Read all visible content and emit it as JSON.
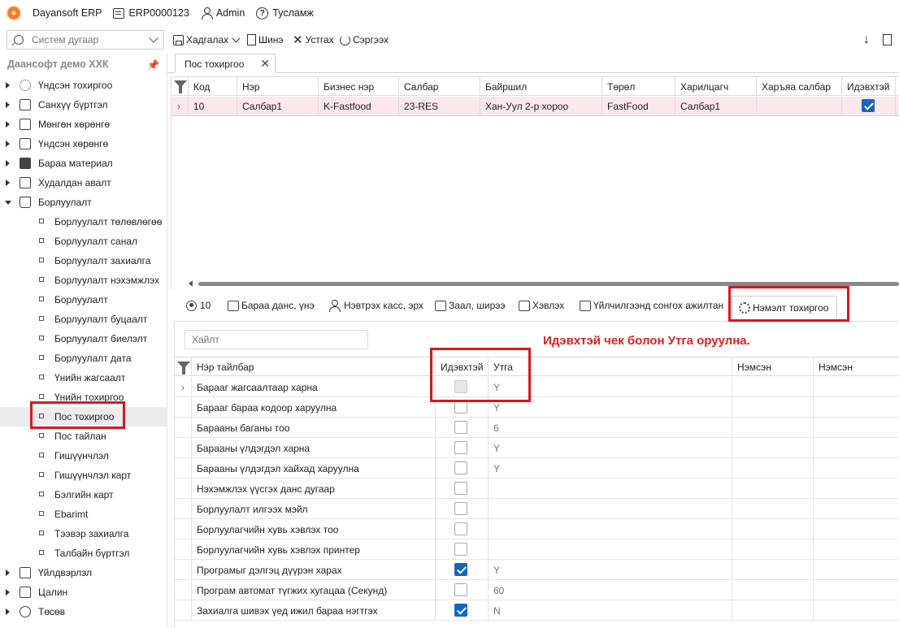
{
  "app": {
    "title": "Dayansoft ERP",
    "doc_code": "ERP0000123",
    "user": "Admin",
    "help": "Тусламж"
  },
  "toolbar": {
    "search_placeholder": "Систем дугаар",
    "save": "Хадгалах",
    "new": "Шинэ",
    "delete": "Устгах",
    "refresh": "Сэргээх"
  },
  "sidebar": {
    "company": "Даансофт демо ХХК",
    "items": [
      {
        "label": "Үндсэн тохиргоо",
        "icon": "gear-icon"
      },
      {
        "label": "Санхүү бүртгэл",
        "icon": "ledger-icon"
      },
      {
        "label": "Мөнгөн хөрөнгө",
        "icon": "money-icon"
      },
      {
        "label": "Үндсэн хөрөнгө",
        "icon": "building-icon"
      },
      {
        "label": "Бараа материал",
        "icon": "inventory-icon"
      },
      {
        "label": "Худалдан авалт",
        "icon": "purchase-icon"
      },
      {
        "label": "Борлуулалт",
        "icon": "cart-icon"
      }
    ],
    "sales_children": [
      "Борлуулалт төлөвлөгөө",
      "Борлуулалт санал",
      "Борлуулалт захиалга",
      "Борлуулалт нэхэмжлэх",
      "Борлуулалт",
      "Борлуулалт буцаалт",
      "Борлуулалт биелэлт",
      "Борлуулалт дата",
      "Үнийн жагсаалт",
      "Үнийн тохиргоо",
      "Пос тохиргоо",
      "Пос тайлан",
      "Гишүүнчлэл",
      "Гишүүнчлэл карт",
      "Бэлгийн карт",
      "Ebarimt",
      "Тээвэр захиалга",
      "Талбайн бүртгэл"
    ],
    "bottom_items": [
      {
        "label": "Үйлдвэрлэл",
        "icon": "factory-icon"
      },
      {
        "label": "Цалин",
        "icon": "calculator-icon"
      },
      {
        "label": "Төсөв",
        "icon": "pie-icon"
      }
    ]
  },
  "tab": {
    "label": "Пос тохиргоо"
  },
  "grid1": {
    "columns": [
      "Код",
      "Нэр",
      "Бизнес нэр",
      "Салбар",
      "Байршил",
      "Төрөл",
      "Харилцагч",
      "Харъяа салбар",
      "Идэвхтэй"
    ],
    "row": [
      "10",
      "Салбар1",
      "K-Fastfood",
      "23-RES",
      "Хан-Уул 2-р хороо",
      "FastFood",
      "Салбар1",
      "",
      ""
    ]
  },
  "subtabs": {
    "count": "10",
    "items": [
      "Бараа данс, үнэ",
      "Нэвтрэх касс, эрх",
      "Заал, ширээ",
      "Хэвлэх",
      "Үйлчилгээнд сонгох ажилтан",
      "Нэмэлт тохиргоо"
    ]
  },
  "panel2": {
    "search_placeholder": "Хайлт",
    "annotation": "Идэвхтэй чек болон Утга оруулна.",
    "columns": [
      "Нэр тайлбар",
      "Идэвхтэй",
      "Утга",
      "Нэмсэн",
      "Нэмсэн"
    ],
    "rows": [
      {
        "name": "Барааг жагсаалтаар харна",
        "active": "disabled",
        "value": "Y"
      },
      {
        "name": "Барааг бараа кодоор харуулна",
        "active": "off",
        "value": "Y"
      },
      {
        "name": "Барааны баганы тоо",
        "active": "off",
        "value": "6"
      },
      {
        "name": "Барааны үлдэгдэл харна",
        "active": "off",
        "value": "Y"
      },
      {
        "name": "Барааны үлдэгдэл хайхад харуулна",
        "active": "off",
        "value": "Y"
      },
      {
        "name": "Нэхэмжлэх үүсгэх данс дугаар",
        "active": "off",
        "value": ""
      },
      {
        "name": "Борлуулалт илгээх мэйл",
        "active": "off",
        "value": ""
      },
      {
        "name": "Борлуулагчийн хувь хэвлэх тоо",
        "active": "off",
        "value": ""
      },
      {
        "name": "Борлуулагчийн хувь хэвлэх принтер",
        "active": "off",
        "value": ""
      },
      {
        "name": "Програмыг дэлгэц дүүрэн харах",
        "active": "on",
        "value": "Y"
      },
      {
        "name": "Програм автомат түгжих хугацаа (Секунд)",
        "active": "off",
        "value": "60"
      },
      {
        "name": "Захиалга шивэх үед ижил бараа нэгтгэх",
        "active": "on",
        "value": "N"
      }
    ]
  },
  "colors": {
    "highlight_red": "#e0141c",
    "selected_row": "#fce8e8",
    "checkbox_blue": "#1565c0"
  }
}
